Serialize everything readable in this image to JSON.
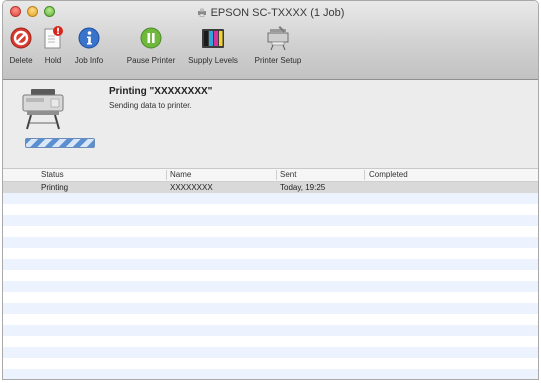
{
  "window": {
    "title": "EPSON SC-TXXXX (1 Job)"
  },
  "toolbar": {
    "delete_label": "Delete",
    "hold_label": "Hold",
    "job_info_label": "Job Info",
    "pause_printer_label": "Pause Printer",
    "supply_levels_label": "Supply Levels",
    "printer_setup_label": "Printer Setup"
  },
  "status": {
    "title": "Printing \"XXXXXXXX\"",
    "message": "Sending data to printer."
  },
  "table": {
    "headers": {
      "status": "Status",
      "name": "Name",
      "sent": "Sent",
      "completed": "Completed"
    },
    "rows": [
      {
        "status": "Printing",
        "name": "XXXXXXXX",
        "sent": "Today, 19:25",
        "completed": ""
      }
    ]
  }
}
